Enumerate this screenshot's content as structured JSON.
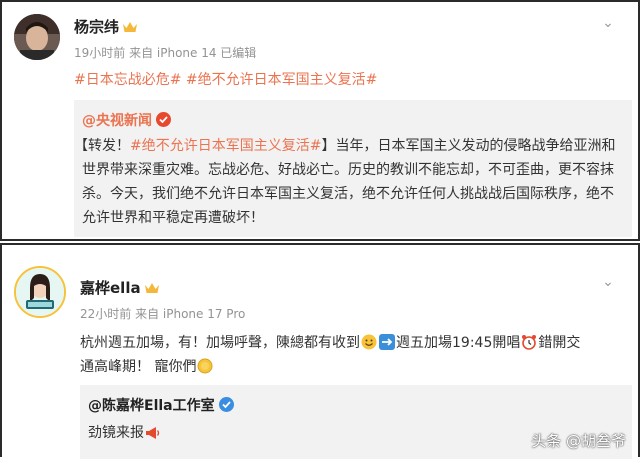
{
  "post1": {
    "author": "杨宗纬",
    "meta": "19小时前 来自 iPhone 14 已编辑",
    "tags": "#日本忘战必危# #绝不允许日本军国主义复活#",
    "quote": {
      "author": "@央视新闻",
      "line1_prefix": "【转发！",
      "line1_tag": "#绝不允许日本军国主义复活#",
      "line1_suffix": "】当年，日本军国主义发动的侵略战争给亚洲和",
      "line2": "世界带来深重灾难。忘战必危、好战必亡。历史的教训不能忘却，不可歪曲，更不容抹",
      "line3": "杀。今天，我们绝不允许日本军国主义复活，绝不允许任何人挑战战后国际秩序，绝不",
      "line4": "允许世界和平稳定再遭破坏！"
    }
  },
  "post2": {
    "author": "嘉桦ella",
    "meta": "22小时前 来自 iPhone 17 Pro",
    "line1_a": "杭州週五加場，有！加場呼聲，陳總都有收到",
    "line1_b": "週五加場19:45開唱",
    "line1_c": "錯開交",
    "line2": "通高峰期！ 寵你們",
    "quote": {
      "author": "@陈嘉桦Ella工作室",
      "text": "劲镜来报"
    }
  },
  "watermark": "头条 @胡叁爷",
  "colors": {
    "accent": "#eb7350",
    "verified": "#f4a71b",
    "meta": "#939393",
    "quote_bg": "#f2f2f2",
    "ring": "#f6c23a"
  },
  "icons": [
    "crown-icon",
    "verified-badge-icon",
    "more-icon",
    "smile-emoji-icon",
    "arrow-right-emoji-icon",
    "alarm-clock-emoji-icon",
    "sun-emoji-icon",
    "megaphone-icon"
  ]
}
